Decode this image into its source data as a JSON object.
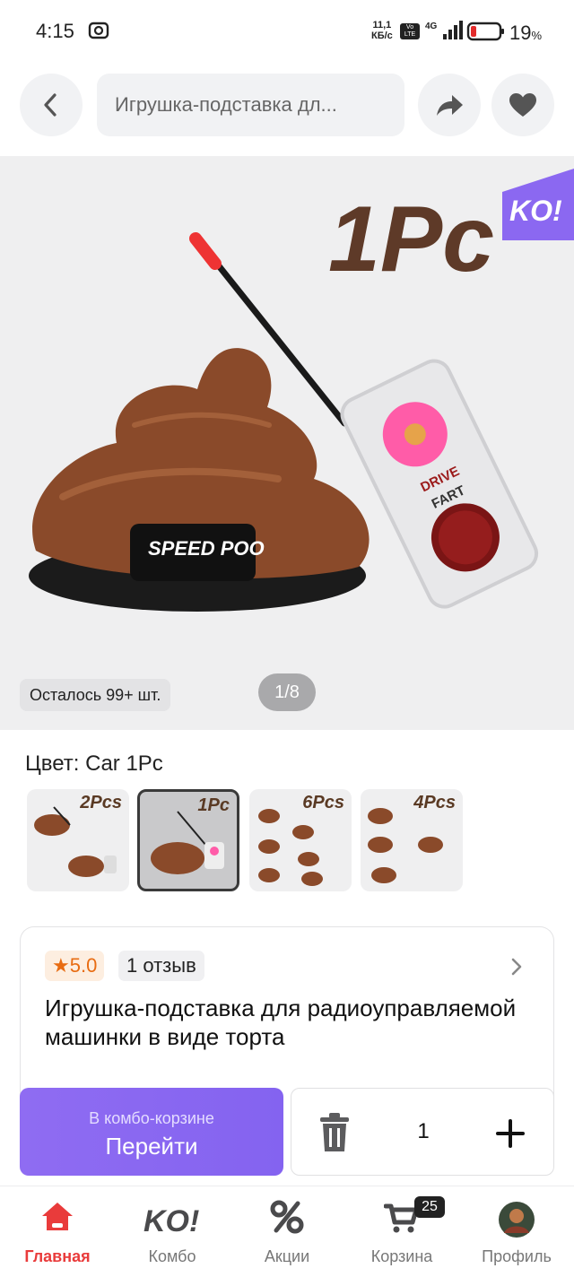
{
  "status_bar": {
    "time": "4:15",
    "net_speed_value": "11,1",
    "net_speed_unit": "КБ/с",
    "volte": "Vo LTE",
    "net_type": "4G",
    "battery_pct": "19",
    "battery_pct_sign": "%"
  },
  "header": {
    "search_text": "Игрушка-подставка дл..."
  },
  "gallery": {
    "headline": "1Pc",
    "ko_badge": "KO!",
    "brand_plate": "SPEED POO",
    "button_drive": "DRIVE",
    "button_fart": "FART",
    "stock_text": "Осталось 99+ шт.",
    "counter": "1/8"
  },
  "variants": {
    "label": "Цвет: Car 1Pc",
    "items": [
      {
        "label": "2Pcs",
        "selected": false
      },
      {
        "label": "1Pc",
        "selected": true
      },
      {
        "label": "6Pcs",
        "selected": false
      },
      {
        "label": "4Pcs",
        "selected": false
      }
    ]
  },
  "product": {
    "rating": "5.0",
    "reviews": "1 отзыв",
    "title": "Игрушка-подставка для радиоуправляемой машинки в виде торта"
  },
  "actions": {
    "combo_caption": "В комбо-корзине",
    "go_label": "Перейти",
    "quantity": "1"
  },
  "bottom_nav": {
    "items": [
      {
        "label": "Главная",
        "icon": "home-icon",
        "active": true
      },
      {
        "label": "Комбо",
        "icon": "ko-logo-icon",
        "active": false
      },
      {
        "label": "Акции",
        "icon": "percent-icon",
        "active": false
      },
      {
        "label": "Корзина",
        "icon": "cart-icon",
        "active": false
      },
      {
        "label": "Профиль",
        "icon": "avatar-icon",
        "active": false
      }
    ],
    "cart_badge": "25"
  },
  "colors": {
    "accent_purple": "#8b68f1",
    "active_red": "#e93b3b",
    "rating_orange": "#e86c12"
  }
}
